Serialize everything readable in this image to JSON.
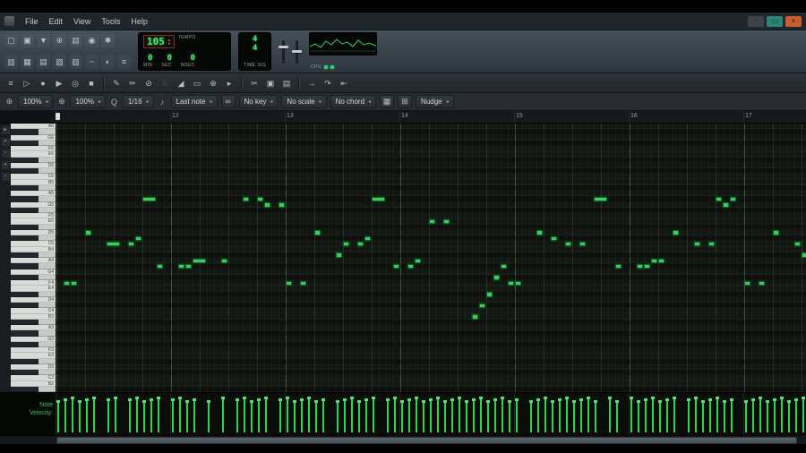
{
  "menubar": {
    "items": [
      "File",
      "Edit",
      "View",
      "Tools",
      "Help"
    ],
    "window_buttons": [
      {
        "name": "window-minimize",
        "glyph": "–",
        "color": "#3a444c"
      },
      {
        "name": "window-maximize",
        "glyph": "▭",
        "color": "#2e8577"
      },
      {
        "name": "window-close",
        "glyph": "×",
        "color": "#c85c2d"
      }
    ]
  },
  "toolbar": {
    "row1": [
      {
        "name": "new-project-icon",
        "glyph": "▢"
      },
      {
        "name": "open-project-icon",
        "glyph": "▣"
      },
      {
        "name": "save-project-icon",
        "glyph": "▼"
      },
      {
        "name": "search-icon",
        "glyph": "⊕"
      },
      {
        "name": "export-icon",
        "glyph": "▤"
      },
      {
        "name": "recent-files-icon",
        "glyph": "◉"
      },
      {
        "name": "notification-bell-icon",
        "glyph": "✱"
      }
    ],
    "row2": [
      {
        "name": "playlist-icon",
        "glyph": "▥"
      },
      {
        "name": "step-sequencer-icon",
        "glyph": "▦"
      },
      {
        "name": "piano-roll-icon",
        "glyph": "▤"
      },
      {
        "name": "mixer-icon",
        "glyph": "▧"
      },
      {
        "name": "browser-icon",
        "glyph": "▨"
      },
      {
        "name": "wave-icon",
        "glyph": "~"
      },
      {
        "name": "metronome-icon",
        "glyph": "◐"
      },
      {
        "name": "typing-keyboard-icon",
        "glyph": "≡"
      }
    ]
  },
  "transport": {
    "tempo": "105",
    "tempo_label": "TEMPO",
    "spinner_up": "▲",
    "spinner_down": "▼",
    "time": {
      "min": "0",
      "sec": "0",
      "msec": "0",
      "labels": [
        "MIN",
        "SEC",
        "MSEC"
      ]
    },
    "timesig": {
      "num": "4",
      "den": "4",
      "label": "TIME SIG"
    },
    "cpu_label": "CPU"
  },
  "pr_toolbar": {
    "buttons": [
      {
        "name": "menu-grip-button",
        "glyph": "≡"
      },
      {
        "name": "play-button",
        "glyph": "▷"
      },
      {
        "name": "record-button",
        "glyph": "●"
      },
      {
        "name": "play-pattern-button",
        "glyph": "▶"
      },
      {
        "name": "loop-record-button",
        "glyph": "◎"
      },
      {
        "name": "stop-button",
        "glyph": "■"
      },
      {
        "sep": true
      },
      {
        "name": "draw-tool-button",
        "glyph": "✎"
      },
      {
        "name": "paint-tool-button",
        "glyph": "✏"
      },
      {
        "name": "delete-tool-button",
        "glyph": "⊘"
      },
      {
        "name": "mute-tool-button",
        "glyph": "◌"
      },
      {
        "name": "slice-tool-button",
        "glyph": "◢"
      },
      {
        "name": "select-tool-button",
        "glyph": "▭"
      },
      {
        "name": "zoom-tool-button",
        "glyph": "⊕"
      },
      {
        "name": "playback-tool-button",
        "glyph": "▸"
      },
      {
        "sep": true
      },
      {
        "name": "cut-button",
        "glyph": "✂"
      },
      {
        "name": "copy-button",
        "glyph": "▣"
      },
      {
        "name": "paste-button",
        "glyph": "▤"
      },
      {
        "sep": true
      },
      {
        "name": "target-channel-button",
        "glyph": "→"
      },
      {
        "name": "smart-tool-button",
        "glyph": "↷"
      },
      {
        "name": "rewind-button",
        "glyph": "⇤"
      }
    ]
  },
  "pr_options": {
    "items": [
      {
        "type": "icon",
        "name": "zoom-horizontal-icon",
        "glyph": "⊕"
      },
      {
        "type": "dropdown",
        "name": "zoom-horizontal-select",
        "value": "100%"
      },
      {
        "type": "icon",
        "name": "zoom-vertical-icon",
        "glyph": "⊕"
      },
      {
        "type": "dropdown",
        "name": "zoom-vertical-select",
        "value": "100%"
      },
      {
        "type": "icon",
        "name": "snap-icon",
        "glyph": "Q"
      },
      {
        "type": "dropdown",
        "name": "snap-select",
        "value": "1/16"
      },
      {
        "type": "icon",
        "name": "note-draw-icon",
        "glyph": "♪"
      },
      {
        "type": "dropdown",
        "name": "draw-note-select",
        "value": "Last note"
      },
      {
        "type": "icon-button",
        "name": "link-notes-button",
        "glyph": "∞"
      },
      {
        "type": "dropdown",
        "name": "key-select",
        "value": "No key"
      },
      {
        "type": "dropdown",
        "name": "scale-select",
        "value": "No scale"
      },
      {
        "type": "dropdown",
        "name": "chord-select",
        "value": "No chord"
      },
      {
        "type": "icon-button",
        "name": "stamp-button",
        "glyph": "▦"
      },
      {
        "type": "icon-button",
        "name": "grid-options-button",
        "glyph": "⊞"
      },
      {
        "type": "dropdown",
        "name": "nudge-select",
        "value": "Nudge"
      }
    ]
  },
  "ui": {
    "dropdown_arrow": "◂"
  },
  "left_strip": [
    {
      "name": "panel-arrow-icon",
      "glyph": "▸"
    },
    {
      "name": "panel-pattern-icon",
      "glyph": "▪"
    },
    {
      "name": "panel-notes-icon",
      "glyph": "▫"
    },
    {
      "name": "panel-ghost-icon",
      "glyph": "▪"
    },
    {
      "name": "panel-misc-icon",
      "glyph": "▫"
    }
  ],
  "piano_roll": {
    "timeline_bars": [
      "12",
      "13",
      "14",
      "15",
      "16",
      "17"
    ],
    "keys": [
      "A6",
      "G#6",
      "G6",
      "F#6",
      "F6",
      "E6",
      "D#6",
      "D6",
      "C#6",
      "C6",
      "B5",
      "A#5",
      "A5",
      "G#5",
      "G5",
      "F#5",
      "F5",
      "E5",
      "D#5",
      "D5",
      "C#5",
      "C5",
      "B4",
      "A#4",
      "A4",
      "G#4",
      "G4",
      "F#4",
      "F4",
      "E4",
      "D#4",
      "D4",
      "C#4",
      "C4",
      "B3",
      "A#3",
      "A3",
      "G#3",
      "G3",
      "F#3",
      "F3",
      "E3",
      "D#3",
      "D3",
      "C#3",
      "C3",
      "B2",
      "A#2"
    ]
  },
  "notes": [
    [
      1,
      28,
      1
    ],
    [
      2,
      28,
      1
    ],
    [
      4,
      19,
      1
    ],
    [
      7,
      21,
      2
    ],
    [
      10,
      21,
      1
    ],
    [
      11,
      20,
      1
    ],
    [
      12,
      13,
      2
    ],
    [
      14,
      25,
      1
    ],
    [
      17,
      25,
      1
    ],
    [
      18,
      25,
      1
    ],
    [
      19,
      24,
      2
    ],
    [
      23,
      24,
      1
    ],
    [
      26,
      13,
      1
    ],
    [
      28,
      13,
      1
    ],
    [
      29,
      14,
      1
    ],
    [
      31,
      14,
      1
    ],
    [
      32,
      28,
      1
    ],
    [
      34,
      28,
      1
    ],
    [
      36,
      19,
      1
    ],
    [
      39,
      23,
      1
    ],
    [
      40,
      21,
      1
    ],
    [
      42,
      21,
      1
    ],
    [
      43,
      20,
      1
    ],
    [
      44,
      13,
      2
    ],
    [
      47,
      25,
      1
    ],
    [
      49,
      25,
      1
    ],
    [
      50,
      24,
      1
    ],
    [
      52,
      17,
      1
    ],
    [
      54,
      17,
      1
    ],
    [
      58,
      34,
      1
    ],
    [
      59,
      32,
      1
    ],
    [
      60,
      30,
      1
    ],
    [
      61,
      27,
      1
    ],
    [
      62,
      25,
      1
    ],
    [
      63,
      28,
      1
    ],
    [
      64,
      28,
      1
    ],
    [
      67,
      19,
      1
    ],
    [
      69,
      20,
      1
    ],
    [
      71,
      21,
      1
    ],
    [
      73,
      21,
      1
    ],
    [
      75,
      13,
      2
    ],
    [
      78,
      25,
      1
    ],
    [
      81,
      25,
      1
    ],
    [
      82,
      25,
      1
    ],
    [
      83,
      24,
      1
    ],
    [
      84,
      24,
      1
    ],
    [
      86,
      19,
      1
    ],
    [
      89,
      21,
      1
    ],
    [
      91,
      21,
      1
    ],
    [
      92,
      13,
      1
    ],
    [
      93,
      14,
      1
    ],
    [
      94,
      13,
      1
    ],
    [
      96,
      28,
      1
    ],
    [
      98,
      28,
      1
    ],
    [
      100,
      19,
      1
    ],
    [
      103,
      21,
      1
    ],
    [
      104,
      23,
      1
    ]
  ],
  "velocity": {
    "label1": "Note",
    "label2": "Velocity:",
    "steps": [
      0,
      1,
      2,
      3,
      4,
      5,
      7,
      8,
      10,
      11,
      12,
      13,
      14,
      16,
      17,
      18,
      19,
      21,
      23,
      25,
      26,
      27,
      28,
      29,
      31,
      32,
      33,
      34,
      35,
      36,
      37,
      39,
      40,
      41,
      42,
      43,
      44,
      46,
      47,
      48,
      49,
      50,
      51,
      52,
      53,
      54,
      55,
      56,
      57,
      58,
      59,
      60,
      61,
      62,
      63,
      64,
      66,
      67,
      68,
      69,
      70,
      71,
      72,
      73,
      74,
      75,
      77,
      78,
      80,
      81,
      82,
      83,
      84,
      85,
      86,
      88,
      89,
      90,
      91,
      92,
      93,
      94,
      96,
      97,
      98,
      99,
      100,
      101,
      102,
      103,
      104
    ]
  },
  "colors": {
    "note_green": "#3fca5f",
    "lcd_green": "#41f06a",
    "velocity_green": "#2fd457",
    "close_orange": "#c85c2d",
    "titlebar_teal": "#2e8577"
  }
}
